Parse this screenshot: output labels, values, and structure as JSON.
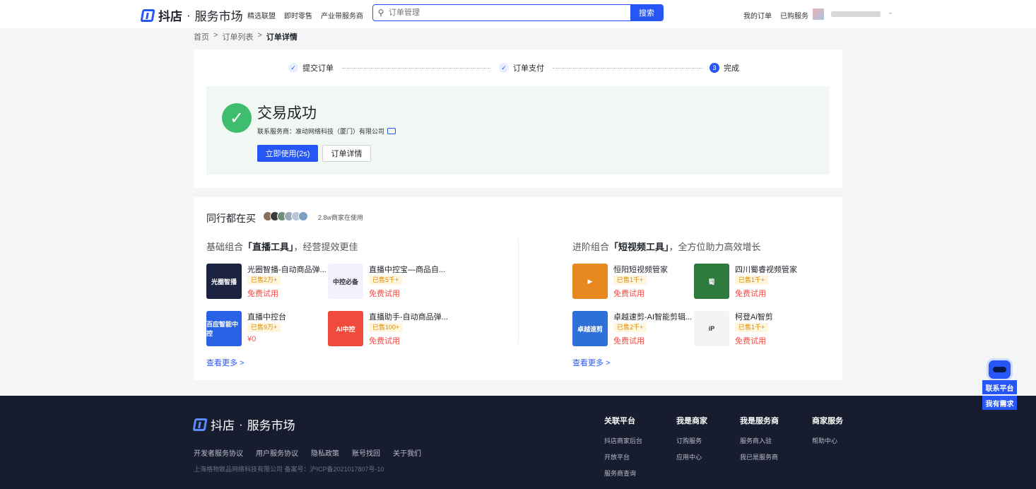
{
  "header": {
    "logo_brand": "抖店",
    "logo_sep": "·",
    "logo_sub": "服务市场",
    "nav": [
      "精选联盟",
      "即时零售",
      "产业带服务商"
    ],
    "search_placeholder": "订单管理",
    "search_button": "搜索",
    "right_links": [
      "我的订单",
      "已购服务"
    ]
  },
  "breadcrumb": {
    "items": [
      "首页",
      "订单列表",
      "订单详情"
    ],
    "sep": ">"
  },
  "steps": [
    {
      "label": "提交订单",
      "state": "done",
      "mark": "✓"
    },
    {
      "label": "订单支付",
      "state": "done",
      "mark": "✓"
    },
    {
      "label": "完成",
      "state": "current",
      "mark": "3"
    }
  ],
  "success": {
    "title": "交易成功",
    "vendor": "联系服务商：准动网络科技（厦门）有限公司",
    "primary_button": "立即使用(2s)",
    "secondary_button": "订单详情"
  },
  "peers": {
    "title": "同行都在买",
    "count_text": "2.8w商家在使用",
    "avatar_colors": [
      "#8a6d5a",
      "#3b3b3b",
      "#6f8d7a",
      "#9aa8b8",
      "#b9c7d8",
      "#7d9fc0"
    ]
  },
  "combos": [
    {
      "prefix": "基础组合",
      "highlight": "「直播工具」",
      "suffix": "，经营提效更佳",
      "more": "查看更多 >",
      "products": [
        {
          "name": "光圈智播-自动商品弹...",
          "sold": "已售2万+",
          "price": "免费试用",
          "thumb_text": "光圈智播",
          "color": "#1b2340"
        },
        {
          "name": "直播中控宝—商品自...",
          "sold": "已售5千+",
          "price": "免费试用",
          "thumb_text": "中控必备",
          "color": "#f4f1ff"
        },
        {
          "name": "直播中控台",
          "sold": "已售9万+",
          "price": "¥0",
          "thumb_text": "百应智能中控",
          "color": "#2a62e6"
        },
        {
          "name": "直播助手-自动商品弹...",
          "sold": "已售100+",
          "price": "免费试用",
          "thumb_text": "AI中控",
          "color": "#ee4b3c"
        }
      ]
    },
    {
      "prefix": "进阶组合",
      "highlight": "「短视频工具」",
      "suffix": "，全方位助力高效增长",
      "more": "查看更多 >",
      "products": [
        {
          "name": "恒阳短视频管家",
          "sold": "已售1千+",
          "price": "免费试用",
          "thumb_text": "▶",
          "color": "#e8891f"
        },
        {
          "name": "四川蜀睿视频管家",
          "sold": "已售1千+",
          "price": "免费试用",
          "thumb_text": "蜀",
          "color": "#2e7a3c"
        },
        {
          "name": "卓越速剪-AI智能剪辑...",
          "sold": "已售2千+",
          "price": "免费试用",
          "thumb_text": "卓越速剪",
          "color": "#2f6fd8"
        },
        {
          "name": "柯登Ai智剪",
          "sold": "已售1千+",
          "price": "免费试用",
          "thumb_text": "iP",
          "color": "#f3f5f2"
        }
      ]
    }
  ],
  "footer": {
    "logo_brand": "抖店",
    "logo_sep": "·",
    "logo_sub": "服务市场",
    "links": [
      "开发者服务协议",
      "用户服务协议",
      "隐私政策",
      "账号找回",
      "关于我们"
    ],
    "copyright": "上海格物致品网络科技有限公司 备案号：沪ICP备2021017807号-10",
    "columns": [
      {
        "title": "关联平台",
        "items": [
          "抖店商家后台",
          "开放平台",
          "服务商查询"
        ]
      },
      {
        "title": "我是商家",
        "items": [
          "订购服务",
          "应用中心"
        ]
      },
      {
        "title": "我是服务商",
        "items": [
          "服务商入驻",
          "我已是服务商"
        ]
      },
      {
        "title": "商家服务",
        "items": [
          "帮助中心"
        ]
      }
    ]
  },
  "float_widget": {
    "contact": "联系平台",
    "need": "我有需求"
  }
}
